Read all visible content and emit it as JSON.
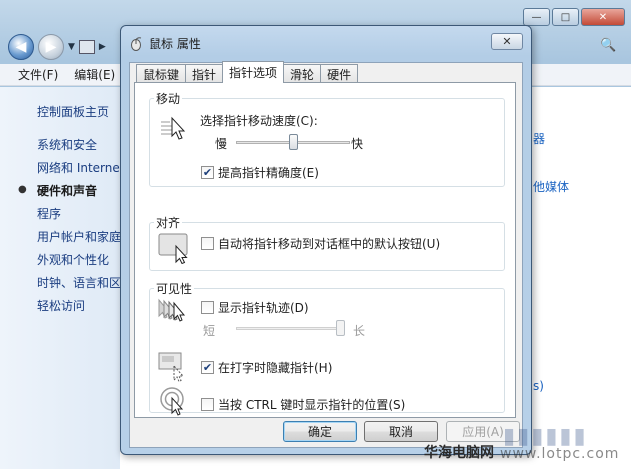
{
  "background_window": {
    "menu": [
      "文件(F)",
      "编辑(E)"
    ],
    "left_nav": {
      "home": "控制面板主页",
      "items": [
        "系统和安全",
        "网络和 Internet",
        "硬件和声音",
        "程序",
        "用户帐户和家庭",
        "外观和个性化",
        "时钟、语言和区",
        "轻松访问"
      ],
      "active_index": 2
    },
    "right_fragments": [
      "器",
      "他媒体",
      "s)"
    ]
  },
  "dialog": {
    "title": "鼠标 属性",
    "tabs": [
      "鼠标键",
      "指针",
      "指针选项",
      "滑轮",
      "硬件"
    ],
    "active_tab_index": 2,
    "motion": {
      "legend": "移动",
      "speed_label": "选择指针移动速度(C):",
      "slow": "慢",
      "fast": "快",
      "speed_value": 0.5,
      "enhance_precision_label": "提高指针精确度(E)",
      "enhance_precision_checked": true
    },
    "snap_to": {
      "legend": "对齐",
      "label": "自动将指针移动到对话框中的默认按钮(U)",
      "checked": false
    },
    "visibility": {
      "legend": "可见性",
      "trails_label": "显示指针轨迹(D)",
      "trails_checked": false,
      "short": "短",
      "long": "长",
      "trails_value": 1.0,
      "hide_typing_label": "在打字时隐藏指针(H)",
      "hide_typing_checked": true,
      "ctrl_show_label": "当按 CTRL 键时显示指针的位置(S)",
      "ctrl_show_checked": false
    },
    "buttons": {
      "ok": "确定",
      "cancel": "取消",
      "apply": "应用(A)"
    }
  },
  "watermark": {
    "site_name": "华海电脑网",
    "url_fragment": "www.lotpc.com"
  },
  "colors": {
    "link": "#1a3d80",
    "dialog_frame": "#b7d0e8",
    "check": "#1d3f7a"
  }
}
